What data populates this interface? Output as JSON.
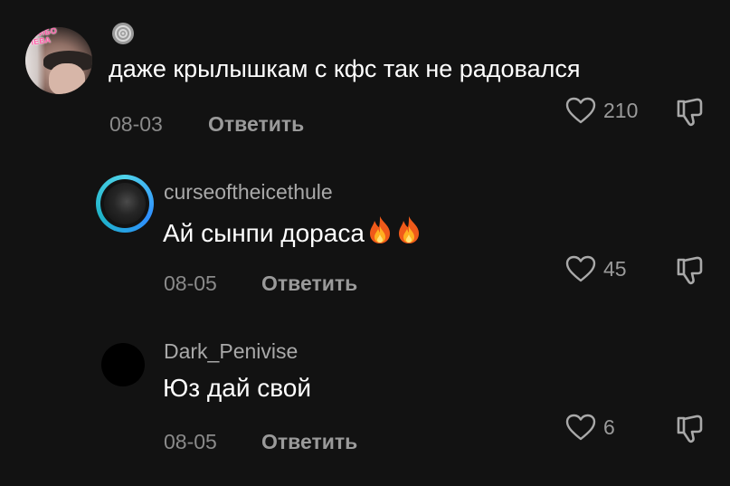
{
  "comments": [
    {
      "text": "даже крылышкам с кфс так не радовался",
      "date": "08-03",
      "reply_label": "Ответить",
      "likes": "210",
      "avatar_sticker": [
        "АСИБО",
        "ЛЕВА"
      ]
    },
    {
      "username": "curseoftheicethule",
      "text": "Ай сынпи дораса",
      "date": "08-05",
      "reply_label": "Ответить",
      "likes": "45"
    },
    {
      "username": "Dark_Penivise",
      "text": "Юз дай свой",
      "date": "08-05",
      "reply_label": "Ответить",
      "likes": "6"
    }
  ],
  "icons": {
    "like": "heart-outline-icon",
    "dislike": "thumbs-down-icon",
    "fire": "fire-emoji",
    "badge": "lollipop-badge-icon"
  },
  "colors": {
    "background": "#121212",
    "primary_text": "#ffffff",
    "secondary_text": "#9a9a9a",
    "story_ring": "#4fd3ea"
  }
}
